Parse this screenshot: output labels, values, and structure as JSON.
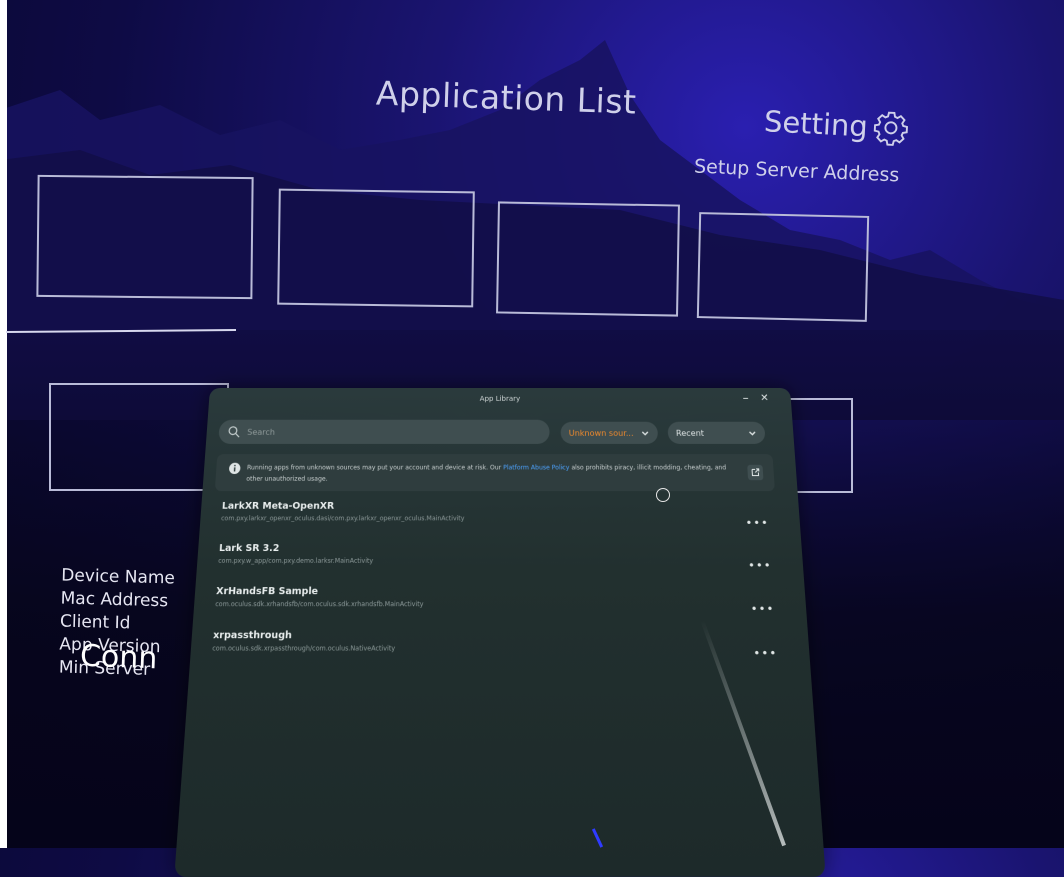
{
  "scene": {
    "title": "Application List",
    "setting_label": "Setting",
    "setup_label": "Setup Server Address",
    "info_labels": [
      "Device Name",
      "Mac Address",
      "Client Id",
      "App Version",
      "Min Server"
    ],
    "conn_label": "Conn"
  },
  "library": {
    "window_title": "App Library",
    "minimize_glyph": "–",
    "close_glyph": "✕",
    "search_placeholder": "Search",
    "source_filter": "Unknown sour...",
    "sort_filter": "Recent",
    "notice_text": "Running apps from unknown sources may put your account and device at risk. Our",
    "notice_link": "Platform Abuse Policy",
    "notice_text2": "also prohibits piracy, illicit modding, cheating, and other unauthorized usage.",
    "apps": [
      {
        "name": "LarkXR Meta-OpenXR",
        "package": "com.pxy.larkxr_openxr_oculus.dasi/com.pxy.larkxr_openxr_oculus.MainActivity"
      },
      {
        "name": "Lark SR 3.2",
        "package": "com.pxy.w_app/com.pxy.demo.larksr.MainActivity"
      },
      {
        "name": "XrHandsFB Sample",
        "package": "com.oculus.sdk.xrhandsfb/com.oculus.sdk.xrhandsfb.MainActivity"
      },
      {
        "name": "xrpassthrough",
        "package": "com.oculus.sdk.xrpassthrough/com.oculus.NativeActivity"
      }
    ],
    "more_glyph": "•••"
  },
  "colors": {
    "accent_orange": "#f08a2c",
    "link_blue": "#4da3ff",
    "panel": "#22302f"
  },
  "icons": [
    "gear-icon",
    "search-icon",
    "chevron-down-icon",
    "info-icon",
    "external-link-icon",
    "more-icon"
  ]
}
